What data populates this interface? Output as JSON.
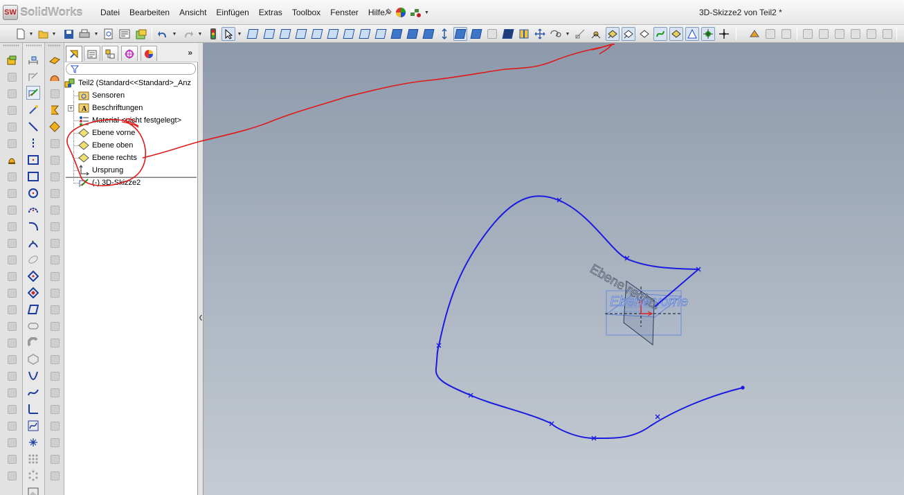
{
  "app": {
    "logo_mark": "SW",
    "logo_text": "SolidWorks",
    "document_title": "3D-Skizze2 von Teil2 *"
  },
  "menu": {
    "items": [
      "Datei",
      "Bearbeiten",
      "Ansicht",
      "Einfügen",
      "Extras",
      "Toolbox",
      "Fenster",
      "Hilfe"
    ]
  },
  "toolbar": {
    "icons": [
      "new-icon",
      "open-icon",
      "save-icon",
      "print-icon",
      "print-preview-icon",
      "options-icon",
      "rebuild-icon",
      "undo-icon",
      "redo-icon",
      "traffic-light-icon",
      "select-arrow-icon",
      "view-orientation-icons",
      "display-style-icons",
      "sketch-tools-icons"
    ]
  },
  "feature_manager": {
    "tabs": [
      "featuremanager-tab",
      "propertymanager-tab",
      "configurationmanager-tab",
      "dimxpert-tab",
      "display-manager-tab"
    ],
    "more_label": "»",
    "filter_value": "",
    "tree": {
      "root": "Teil2  (Standard<<Standard>_Anz",
      "items": [
        {
          "label": "Sensoren",
          "icon": "sensor-folder-icon"
        },
        {
          "label": "Beschriftungen",
          "icon": "annotations-icon"
        },
        {
          "label": "Material <nicht festgelegt>",
          "icon": "material-icon"
        },
        {
          "label": "Ebene vorne",
          "icon": "plane-icon"
        },
        {
          "label": "Ebene oben",
          "icon": "plane-icon"
        },
        {
          "label": "Ebene rechts",
          "icon": "plane-icon"
        },
        {
          "label": "Ursprung",
          "icon": "origin-icon"
        }
      ],
      "sketch_item": "(-) 3D-Skizze2"
    }
  },
  "viewport": {
    "plane_labels": [
      "Ebene rechts",
      "Ebene vorne"
    ],
    "background_top": "#8d9aac",
    "background_bottom": "#c5cbd3",
    "spline_color": "#1a1ae0",
    "annotation_color": "#e01818"
  }
}
